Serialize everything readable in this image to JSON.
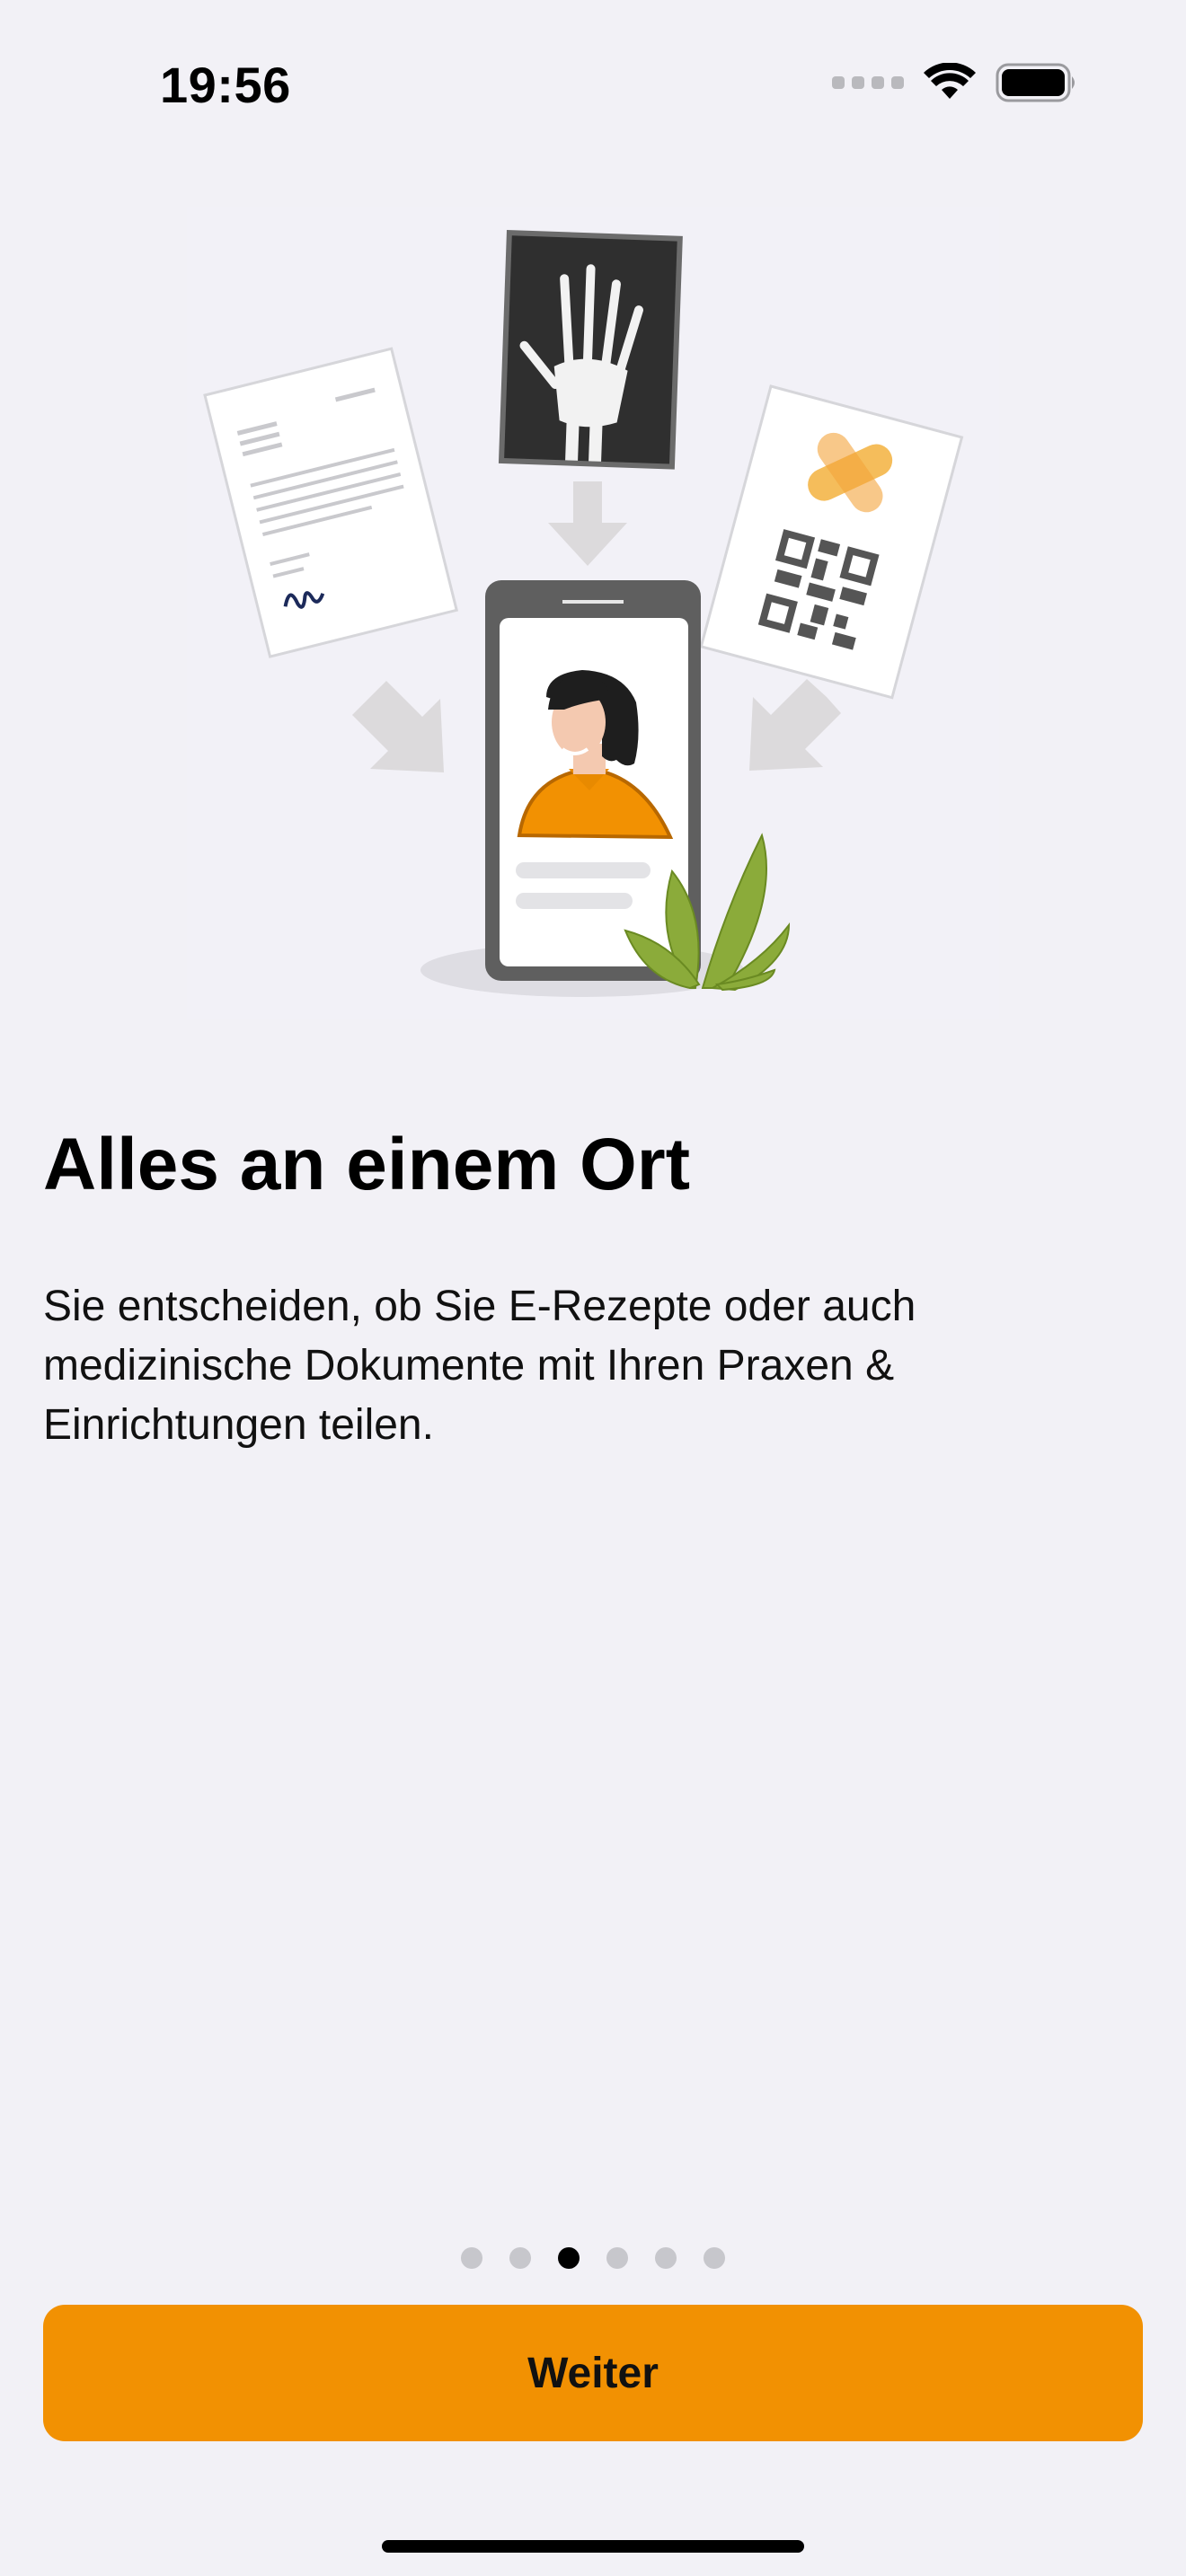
{
  "status_bar": {
    "time": "19:56",
    "icons": [
      "cellular-signal-icon",
      "wifi-icon",
      "battery-icon"
    ]
  },
  "onboarding": {
    "illustration": "documents-to-phone-illustration",
    "title": "Alles an einem Ort",
    "description": "Sie entscheiden, ob Sie E-Rezepte oder auch medizinische Dokumente mit Ihren Praxen & Einrichtungen teilen.",
    "page_count": 6,
    "current_page": 3,
    "next_button_label": "Weiter"
  },
  "colors": {
    "background": "#f2f1f6",
    "accent": "#f29102",
    "plant_green": "#8bab3a",
    "person_orange": "#f29102"
  }
}
